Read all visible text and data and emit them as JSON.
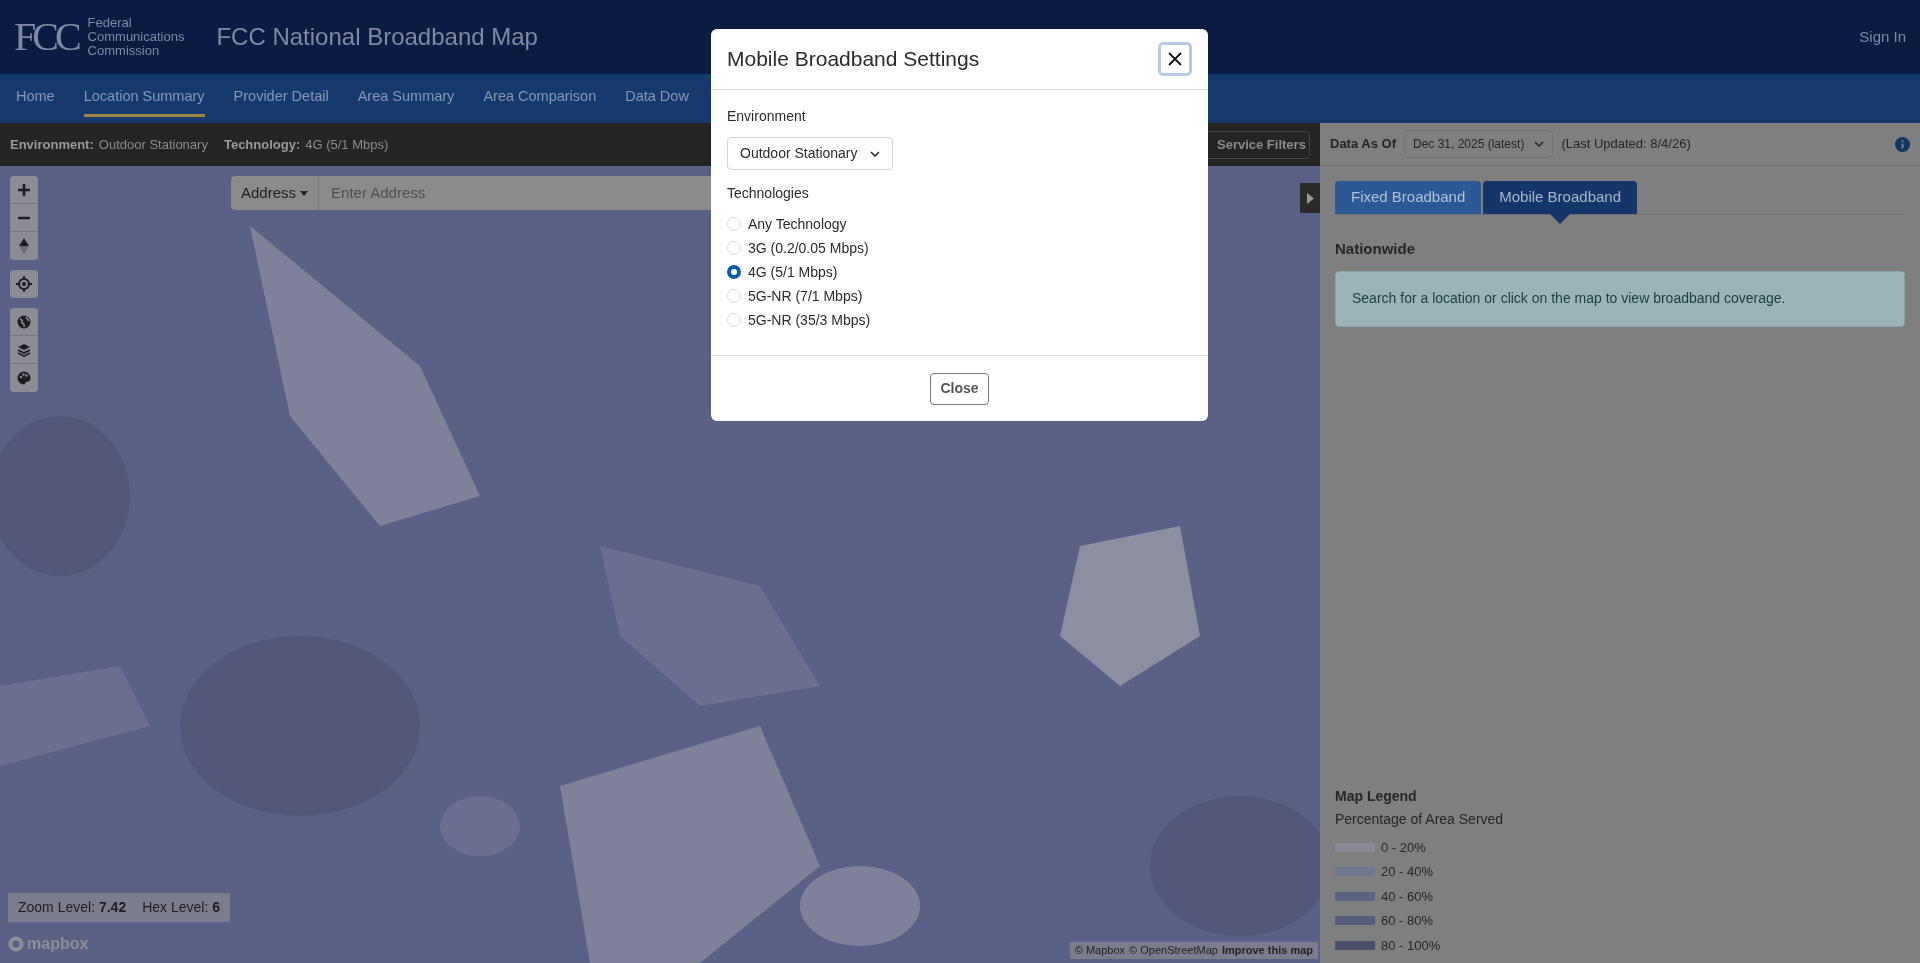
{
  "header": {
    "logo_text": "FCC",
    "org_lines": [
      "Federal",
      "Communications",
      "Commission"
    ],
    "app_title": "FCC National Broadband Map",
    "sign_in": "Sign In"
  },
  "nav": [
    {
      "label": "Home",
      "selected": false
    },
    {
      "label": "Location Summary",
      "selected": true
    },
    {
      "label": "Provider Detail",
      "selected": false
    },
    {
      "label": "Area Summary",
      "selected": false
    },
    {
      "label": "Area Comparison",
      "selected": false
    },
    {
      "label": "Data Dow",
      "selected": false
    }
  ],
  "filter_bar": {
    "environment_label": "Environment:",
    "environment_value": "Outdoor Stationary",
    "technology_label": "Technology:",
    "technology_value": "4G (5/1 Mbps)",
    "service_filters": "Service Filters"
  },
  "map": {
    "search": {
      "type_button": "Address",
      "placeholder": "Enter Address"
    },
    "status": {
      "zoom_label": "Zoom Level:",
      "zoom_value": "7.42",
      "hex_label": "Hex Level:",
      "hex_value": "6"
    },
    "logo": "mapbox",
    "attribution": [
      "© Mapbox",
      "© OpenStreetMap",
      "Improve this map"
    ]
  },
  "data_bar": {
    "label": "Data As Of",
    "date_select": "Dec 31, 2025 (latest)",
    "last_updated": "(Last Updated: 8/4/26)"
  },
  "panel": {
    "tabs": [
      {
        "label": "Fixed Broadband",
        "selected": false
      },
      {
        "label": "Mobile Broadband",
        "selected": true
      }
    ],
    "heading": "Nationwide",
    "message": "Search for a location or click on the map to view broadband coverage.",
    "legend": {
      "title": "Map Legend",
      "subtitle": "Percentage of Area Served",
      "items": [
        {
          "label": "0 - 20%",
          "color": "#8a8a94"
        },
        {
          "label": "20 - 40%",
          "color": "#717690"
        },
        {
          "label": "40 - 60%",
          "color": "#5d6385"
        },
        {
          "label": "60 - 80%",
          "color": "#565c7e"
        },
        {
          "label": "80 - 100%",
          "color": "#4b4f6c"
        }
      ]
    }
  },
  "modal": {
    "title": "Mobile Broadband Settings",
    "environment_label": "Environment",
    "environment_select": "Outdoor Stationary",
    "technologies_label": "Technologies",
    "technologies": [
      {
        "label": "Any Technology",
        "selected": false
      },
      {
        "label": "3G (0.2/0.05 Mbps)",
        "selected": false
      },
      {
        "label": "4G (5/1 Mbps)",
        "selected": true
      },
      {
        "label": "5G-NR (7/1 Mbps)",
        "selected": false
      },
      {
        "label": "5G-NR (35/3 Mbps)",
        "selected": false
      }
    ],
    "close_button": "Close"
  }
}
